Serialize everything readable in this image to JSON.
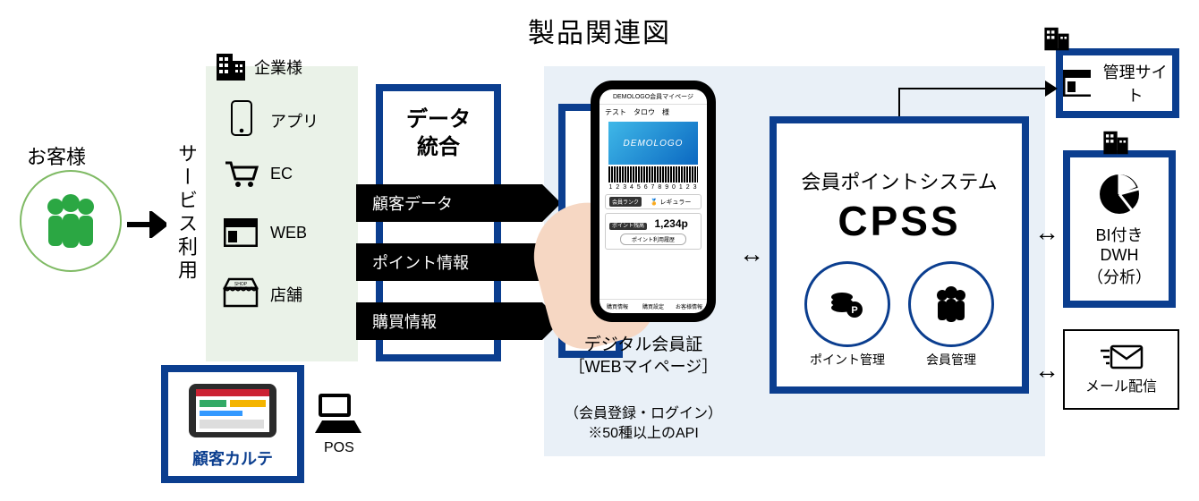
{
  "title": "製品関連図",
  "customer": {
    "label": "お客様"
  },
  "service_use": "サービス利用",
  "enterprise": {
    "label": "企業様",
    "channels": [
      {
        "name": "app",
        "label": "アプリ"
      },
      {
        "name": "ec",
        "label": "EC"
      },
      {
        "name": "web",
        "label": "WEB"
      },
      {
        "name": "store",
        "label": "店舗"
      }
    ]
  },
  "karte": {
    "label": "顧客カルテ"
  },
  "pos": {
    "label": "POS"
  },
  "data_integration": {
    "title": "データ\n統合",
    "bars": [
      {
        "label": "顧客データ"
      },
      {
        "label": "ポイント情報"
      },
      {
        "label": "購買情報"
      }
    ]
  },
  "digital_card": {
    "title1": "デジタル会員証",
    "title2": "［WEBマイページ］",
    "note1": "（会員登録・ログイン）",
    "note2": "※50種以上のAPI",
    "phone": {
      "header": "DEMOLOGO会員マイページ",
      "username": "テスト　タロウ　様",
      "logo": "DEMOLOGO",
      "barcode_number": "1 2 3 4 5 6 7 8 9 0 1 2 3",
      "rank_label": "会員ランク",
      "rank_value": "レギュラー",
      "points_label": "ポイント残高",
      "points_value": "1,234p",
      "detail_btn": "ポイント利用履歴",
      "nav": [
        "購買情報",
        "購買設定",
        "お客様情報"
      ]
    }
  },
  "cpss": {
    "title": "会員ポイントシステム",
    "name": "CPSS",
    "sub": [
      {
        "name": "point-mgmt",
        "label": "ポイント管理"
      },
      {
        "name": "member-mgmt",
        "label": "会員管理"
      }
    ]
  },
  "admin_site": {
    "label": "管理サイト"
  },
  "bi_dwh": {
    "line1": "BI付き",
    "line2": "DWH",
    "line3": "（分析）"
  },
  "mail": {
    "label": "メール配信"
  }
}
